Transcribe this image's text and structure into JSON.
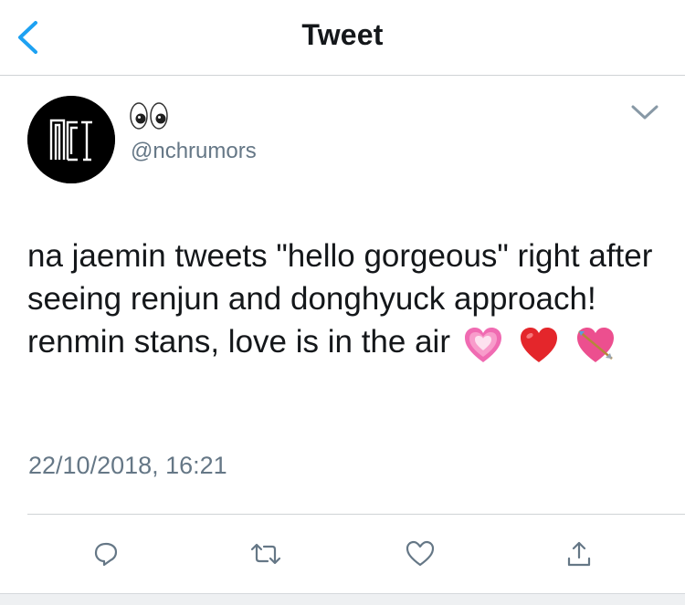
{
  "nav": {
    "title": "Tweet"
  },
  "tweet": {
    "handle": "@nchrumors",
    "text": "na jaemin tweets \"hello gorgeous\" right after seeing renjun and donghyuck approach! renmin stans, love is in the air",
    "timestamp": "22/10/2018, 16:21"
  },
  "colors": {
    "accent": "#1da1f2",
    "secondary_text": "#657786",
    "divider": "#cfd3d6",
    "avatar_bg": "#000000"
  },
  "icons": {
    "back": "chevron-left-icon",
    "avatar": "nct-logo",
    "display_name": "eyes-emoji",
    "caret": "chevron-down-icon",
    "emojis": [
      "growing-heart-emoji",
      "red-heart-emoji",
      "heart-with-arrow-emoji"
    ],
    "actions": [
      "reply-icon",
      "retweet-icon",
      "like-icon",
      "share-icon"
    ]
  }
}
